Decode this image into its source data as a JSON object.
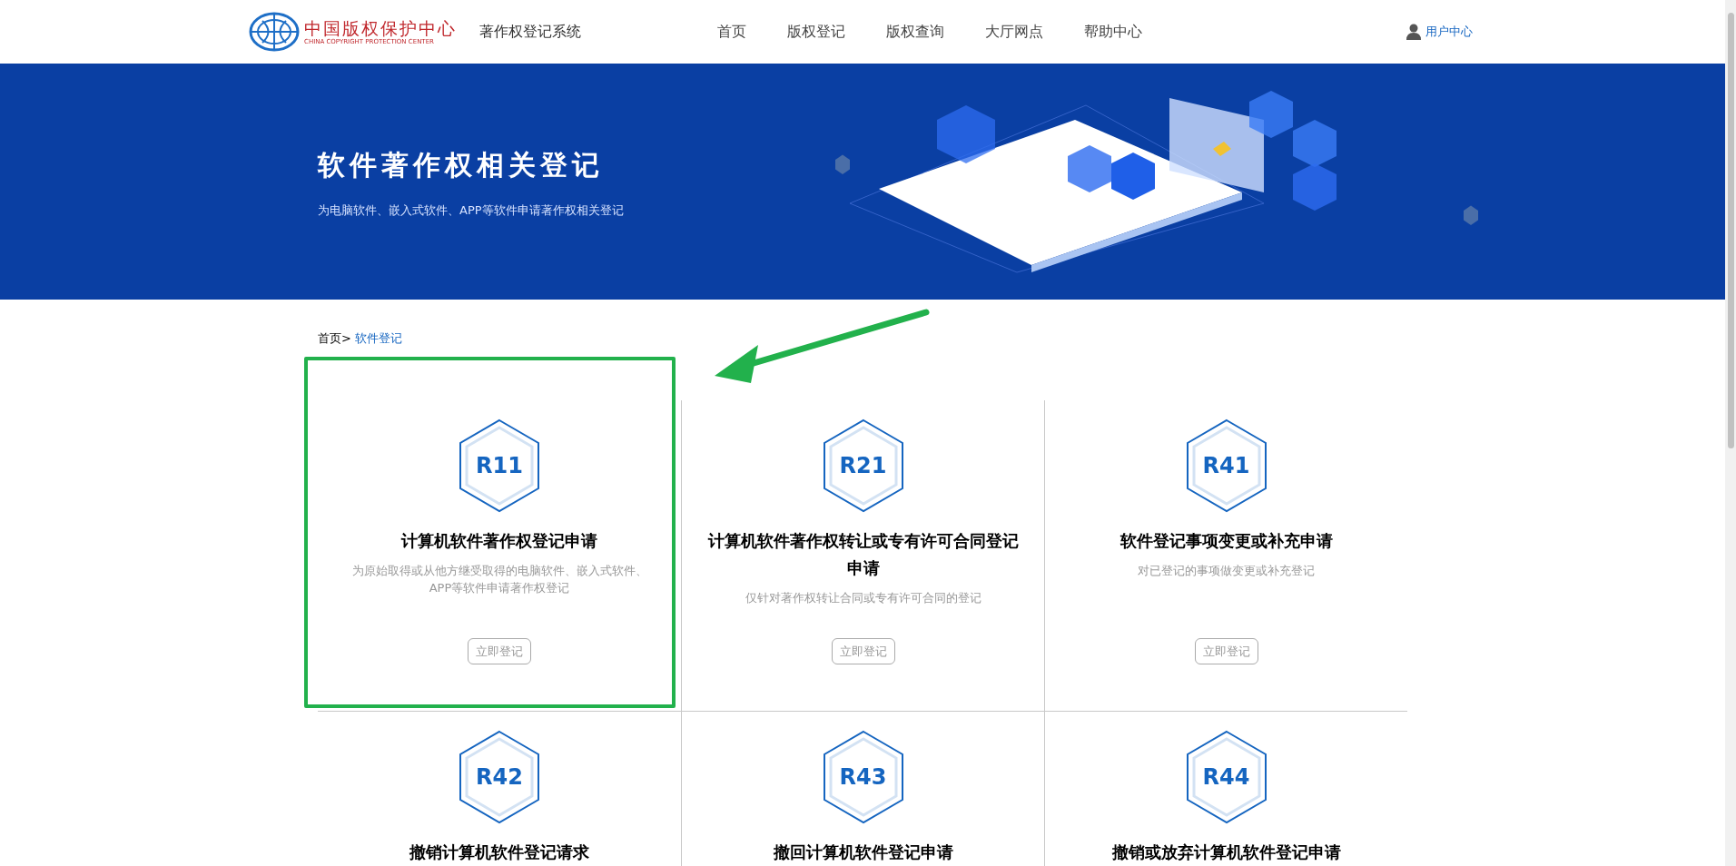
{
  "header": {
    "logo_cn": "中国版权保护中心",
    "logo_en": "CHINA COPYRIGHT PROTECTION CENTER",
    "system_name": "著作权登记系统",
    "nav": [
      {
        "label": "首页",
        "selected": false
      },
      {
        "label": "版权登记",
        "selected": false
      },
      {
        "label": "版权查询",
        "selected": false
      },
      {
        "label": "大厅网点",
        "selected": false
      },
      {
        "label": "帮助中心",
        "selected": false
      }
    ],
    "user_center": "用户中心"
  },
  "banner": {
    "title": "软件著作权相关登记",
    "subtitle": "为电脑软件、嵌入式软件、APP等软件申请著作权相关登记"
  },
  "breadcrumb": {
    "home": "首页>",
    "current": "软件登记"
  },
  "cards": [
    {
      "code": "R11",
      "title": "计算机软件著作权登记申请",
      "description": "为原始取得或从他方继受取得的电脑软件、嵌入式软件、APP等软件申请著作权登记",
      "button": "立即登记",
      "highlighted": true
    },
    {
      "code": "R21",
      "title": "计算机软件著作权转让或专有许可合同登记申请",
      "description": "仅针对著作权转让合同或专有许可合同的登记",
      "button": "立即登记",
      "highlighted": false
    },
    {
      "code": "R41",
      "title": "软件登记事项变更或补充申请",
      "description": "对已登记的事项做变更或补充登记",
      "button": "立即登记",
      "highlighted": false
    },
    {
      "code": "R42",
      "title": "撤销计算机软件登记请求",
      "highlighted": false
    },
    {
      "code": "R43",
      "title": "撤回计算机软件登记申请",
      "highlighted": false
    },
    {
      "code": "R44",
      "title": "撤销或放弃计算机软件登记申请",
      "highlighted": false
    }
  ]
}
